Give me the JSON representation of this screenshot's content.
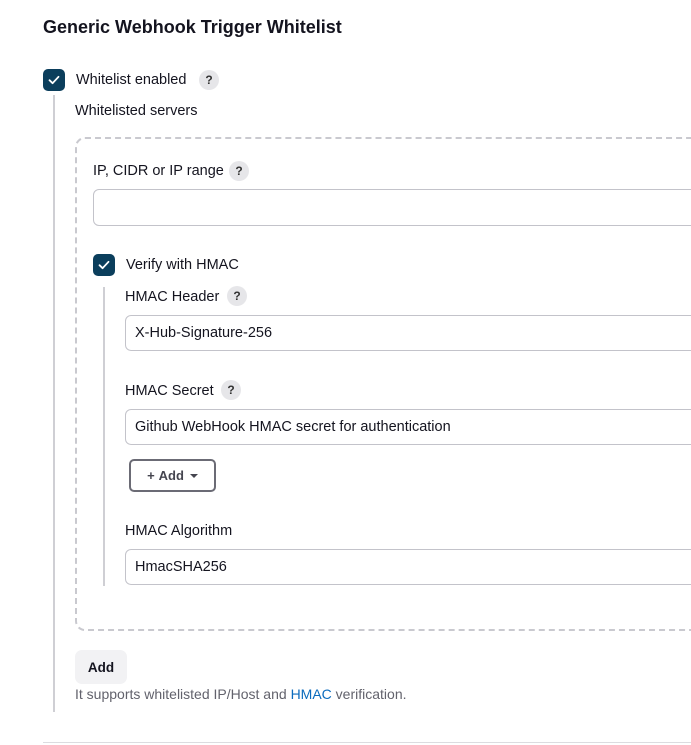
{
  "section": {
    "title": "Generic Webhook Trigger Whitelist"
  },
  "whitelist": {
    "checked": true,
    "label": "Whitelist enabled",
    "help": "?"
  },
  "servers": {
    "label": "Whitelisted servers",
    "ip": {
      "label": "IP, CIDR or IP range",
      "help": "?",
      "value": ""
    },
    "verify": {
      "checked": true,
      "label": "Verify with HMAC"
    },
    "hmac_header": {
      "label": "HMAC Header",
      "help": "?",
      "value": "X-Hub-Signature-256"
    },
    "hmac_secret": {
      "label": "HMAC Secret",
      "help": "?",
      "value": "Github WebHook HMAC secret for authentication"
    },
    "add_dropdown": {
      "plus": "+",
      "label": "Add"
    },
    "hmac_algorithm": {
      "label": "HMAC Algorithm",
      "value": "HmacSHA256"
    }
  },
  "add_button": {
    "label": "Add"
  },
  "help_text": {
    "prefix": "It supports whitelisted IP/Host and ",
    "link": "HMAC",
    "suffix": " verification."
  },
  "colors": {
    "checkbox": "#0b3e5c",
    "link": "#0b6bbd",
    "text": "#14141f",
    "muted": "#62626c"
  }
}
